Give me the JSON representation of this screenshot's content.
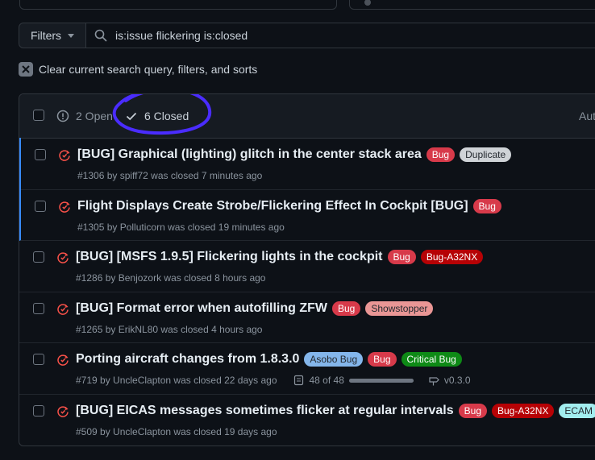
{
  "filters_label": "Filters",
  "search": {
    "value": "is:issue flickering is:closed"
  },
  "clear_label": "Clear current search query, filters, and sorts",
  "header": {
    "open_label": "2 Open",
    "closed_label": "6 Closed",
    "author_label": "Author"
  },
  "colors": {
    "accent_blue": "#388bfd",
    "annotation": "#4a2cff",
    "closed_icon": "#f85149"
  },
  "issues": [
    {
      "title": "[BUG] Graphical (lighting) glitch in the center stack area",
      "labels": [
        {
          "text": "Bug",
          "bg": "#d73a4a",
          "fg": "#ffffff"
        },
        {
          "text": "Duplicate",
          "bg": "#cfd3d7",
          "fg": "#24292f"
        }
      ],
      "meta": "#1306 by spiff72 was closed 7 minutes ago",
      "unread": true
    },
    {
      "title": "Flight Displays Create Strobe/Flickering Effect In Cockpit [BUG]",
      "labels": [
        {
          "text": "Bug",
          "bg": "#d73a4a",
          "fg": "#ffffff"
        }
      ],
      "meta": "#1305 by Polluticorn was closed 19 minutes ago",
      "unread": true
    },
    {
      "title": "[BUG] [MSFS 1.9.5] Flickering lights in the cockpit",
      "labels": [
        {
          "text": "Bug",
          "bg": "#d73a4a",
          "fg": "#ffffff"
        },
        {
          "text": "Bug-A32NX",
          "bg": "#b60205",
          "fg": "#ffffff"
        }
      ],
      "meta": "#1286 by Benjozork was closed 8 hours ago",
      "unread": false
    },
    {
      "title": "[BUG] Format error when autofilling ZFW",
      "labels": [
        {
          "text": "Bug",
          "bg": "#d73a4a",
          "fg": "#ffffff"
        },
        {
          "text": "Showstopper",
          "bg": "#e99695",
          "fg": "#24292f"
        }
      ],
      "meta": "#1265 by ErikNL80 was closed 4 hours ago",
      "unread": false
    },
    {
      "title": "Porting aircraft changes from 1.8.3.0",
      "labels": [
        {
          "text": "Asobo Bug",
          "bg": "#84b6eb",
          "fg": "#24292f"
        },
        {
          "text": "Bug",
          "bg": "#d73a4a",
          "fg": "#ffffff"
        },
        {
          "text": "Critical Bug",
          "bg": "#0e8a16",
          "fg": "#ffffff"
        }
      ],
      "meta": "#719 by UncleClapton was closed 22 days ago",
      "unread": false,
      "tasks": "48 of 48",
      "task_progress": 1.0,
      "milestone": "v0.3.0"
    },
    {
      "title": "[BUG] EICAS messages sometimes flicker at regular intervals",
      "labels": [
        {
          "text": "Bug",
          "bg": "#d73a4a",
          "fg": "#ffffff"
        },
        {
          "text": "Bug-A32NX",
          "bg": "#b60205",
          "fg": "#ffffff"
        },
        {
          "text": "ECAM",
          "bg": "#a2eeef",
          "fg": "#24292f"
        }
      ],
      "meta": "#509 by UncleClapton was closed 19 days ago",
      "unread": false
    }
  ]
}
